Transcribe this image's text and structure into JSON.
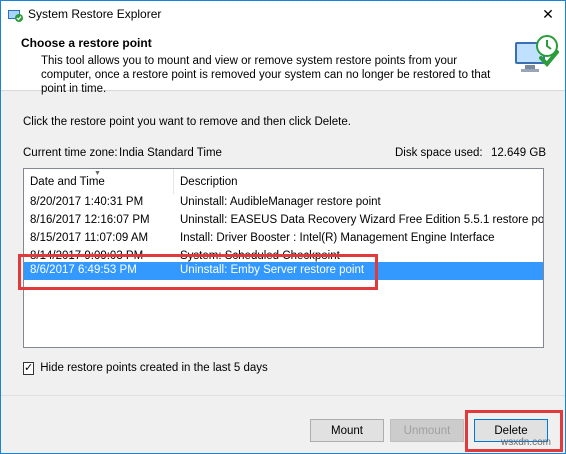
{
  "window": {
    "title": "System Restore Explorer",
    "close_glyph": "✕"
  },
  "header": {
    "title": "Choose a restore point",
    "description": "This tool allows you to mount and view or remove system restore points from your computer, once a restore point is removed your system can no longer be restored to that point in time."
  },
  "instruction": "Click the restore point you want to remove and then click Delete.",
  "timezone": {
    "label": "Current time zone:",
    "value": "India Standard Time"
  },
  "disk": {
    "label": "Disk space used:",
    "value": "12.649 GB"
  },
  "list": {
    "columns": [
      "Date and Time",
      "Description"
    ],
    "rows": [
      {
        "date": "8/20/2017 1:40:31 PM",
        "description": "Uninstall: AudibleManager restore point"
      },
      {
        "date": "8/16/2017 12:16:07 PM",
        "description": "Uninstall: EASEUS Data Recovery Wizard Free Edition 5.5.1 restore point"
      },
      {
        "date": "8/15/2017 11:07:09 AM",
        "description": "Install: Driver Booster : Intel(R) Management Engine Interface"
      },
      {
        "date": "8/14/2017 9:09:03 PM",
        "description": "System: Scheduled Checkpoint"
      },
      {
        "date": "8/6/2017 6:49:53 PM",
        "description": "Uninstall: Emby Server restore point"
      }
    ],
    "selected_index": 4
  },
  "filter": {
    "label": "Hide restore points created in the last 5 days",
    "checked": true,
    "check_glyph": "✓"
  },
  "buttons": {
    "mount": "Mount",
    "unmount": "Unmount",
    "delete": "Delete"
  },
  "watermark": "wsxdn.com",
  "colors": {
    "selection": "#3399ff",
    "highlight": "#e03a3a",
    "accent": "#0078d7"
  },
  "icons": {
    "app": "restore-shield-icon",
    "header": "computer-restore-icon"
  }
}
